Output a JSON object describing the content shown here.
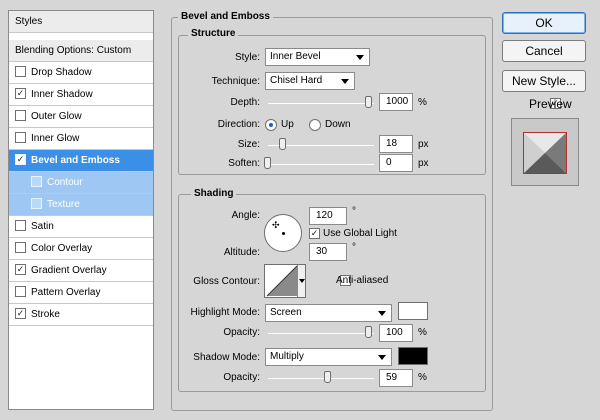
{
  "styles_list": {
    "header": "Styles",
    "blending_options": "Blending Options: Custom",
    "items": [
      {
        "label": "Drop Shadow",
        "checked": false,
        "check": ""
      },
      {
        "label": "Inner Shadow",
        "checked": true,
        "check": "✓"
      },
      {
        "label": "Outer Glow",
        "checked": false,
        "check": ""
      },
      {
        "label": "Inner Glow",
        "checked": false,
        "check": ""
      },
      {
        "label": "Bevel and Emboss",
        "checked": true,
        "check": "✓"
      },
      {
        "label": "Contour",
        "checked": false,
        "check": ""
      },
      {
        "label": "Texture",
        "checked": false,
        "check": ""
      },
      {
        "label": "Satin",
        "checked": false,
        "check": ""
      },
      {
        "label": "Color Overlay",
        "checked": false,
        "check": ""
      },
      {
        "label": "Gradient Overlay",
        "checked": true,
        "check": "✓"
      },
      {
        "label": "Pattern Overlay",
        "checked": false,
        "check": ""
      },
      {
        "label": "Stroke",
        "checked": true,
        "check": "✓"
      }
    ]
  },
  "panel": {
    "title": "Bevel and Emboss",
    "structure": {
      "title": "Structure",
      "style_label": "Style:",
      "style_value": "Inner Bevel",
      "technique_label": "Technique:",
      "technique_value": "Chisel Hard",
      "depth_label": "Depth:",
      "depth_value": "1000",
      "depth_unit": "%",
      "direction_label": "Direction:",
      "direction_up": "Up",
      "direction_down": "Down",
      "direction_selected": "Up",
      "size_label": "Size:",
      "size_value": "18",
      "size_unit": "px",
      "soften_label": "Soften:",
      "soften_value": "0",
      "soften_unit": "px"
    },
    "shading": {
      "title": "Shading",
      "angle_label": "Angle:",
      "angle_value": "120",
      "angle_unit": "°",
      "global_light_label": "Use Global Light",
      "global_light_check": "✓",
      "altitude_label": "Altitude:",
      "altitude_value": "30",
      "altitude_unit": "°",
      "gloss_contour_label": "Gloss Contour:",
      "anti_aliased_label": "Anti-aliased",
      "highlight_mode_label": "Highlight Mode:",
      "highlight_mode_value": "Screen",
      "highlight_color": "#ffffff",
      "highlight_opacity_label": "Opacity:",
      "highlight_opacity_value": "100",
      "highlight_opacity_unit": "%",
      "shadow_mode_label": "Shadow Mode:",
      "shadow_mode_value": "Multiply",
      "shadow_color": "#000000",
      "shadow_opacity_label": "Opacity:",
      "shadow_opacity_value": "59",
      "shadow_opacity_unit": "%"
    }
  },
  "buttons": {
    "ok": "OK",
    "cancel": "Cancel",
    "new_style": "New Style...",
    "preview_label": "Preview",
    "preview_check": "✓"
  },
  "colors": {
    "selected_row": "#3c8fe6",
    "sub_row": "#9ec8f3",
    "dialog_bg": "#d6d6d6"
  }
}
